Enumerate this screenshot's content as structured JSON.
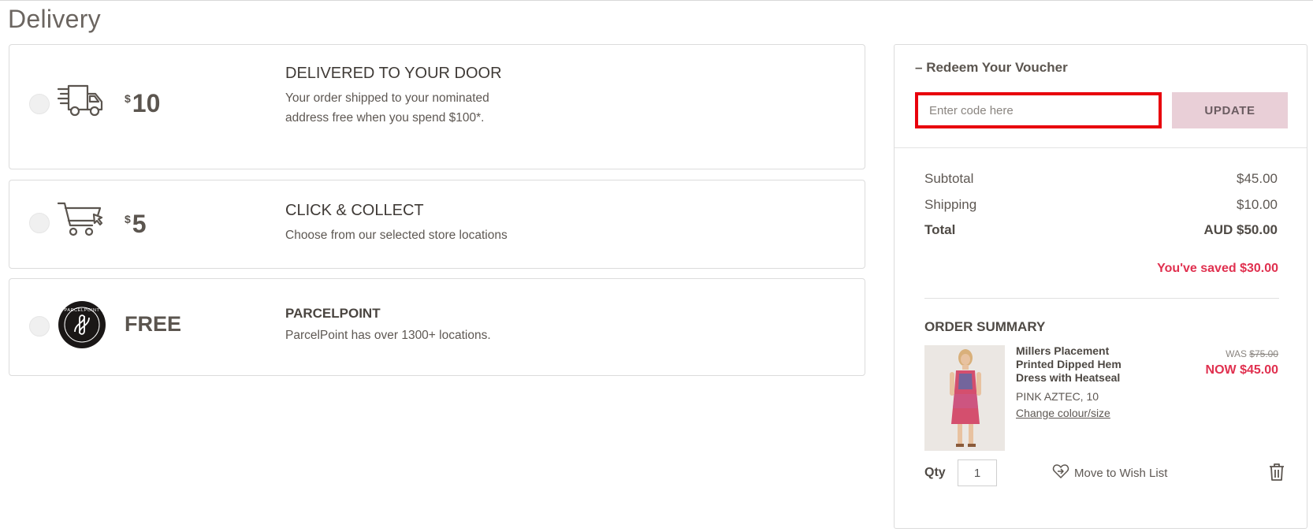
{
  "page": {
    "title": "Delivery"
  },
  "delivery_options": [
    {
      "price_symbol": "$",
      "price_amount": "10",
      "title": "DELIVERED TO YOUR DOOR",
      "desc_line1": "Your order shipped to your nominated",
      "desc_line2": "address free when you spend $100*.",
      "icon": "delivery-truck-icon"
    },
    {
      "price_symbol": "$",
      "price_amount": "5",
      "title": "CLICK & COLLECT",
      "desc_line1": "Choose from our selected store locations",
      "icon": "shopping-cart-icon"
    },
    {
      "price_label": "FREE",
      "title": "PARCELPOINT",
      "desc_line1": "ParcelPoint has over 1300+ locations.",
      "icon": "parcelpoint-logo",
      "logo_text": "PARCELPOINT"
    }
  ],
  "voucher": {
    "toggle": "–",
    "title": "Redeem Your Voucher",
    "placeholder": "Enter code here",
    "button": "UPDATE"
  },
  "summary": {
    "subtotal_label": "Subtotal",
    "subtotal_value": "$45.00",
    "shipping_label": "Shipping",
    "shipping_value": "$10.00",
    "total_label": "Total",
    "total_value": "AUD $50.00",
    "saved": "You've saved $30.00"
  },
  "order": {
    "title": "ORDER SUMMARY",
    "item": {
      "name": "Millers Placement Printed Dipped Hem Dress with Heatseal",
      "was_label": "WAS",
      "was_price": "$75.00",
      "now_price": "NOW $45.00",
      "variant": "PINK AZTEC, 10",
      "change_link": "Change colour/size",
      "qty_label": "Qty",
      "qty_value": "1",
      "wishlist": "Move to Wish List"
    }
  },
  "colors": {
    "accent_sale": "#e0304f",
    "update_button": "#e9cfd7",
    "focus_border": "#e8000c"
  }
}
